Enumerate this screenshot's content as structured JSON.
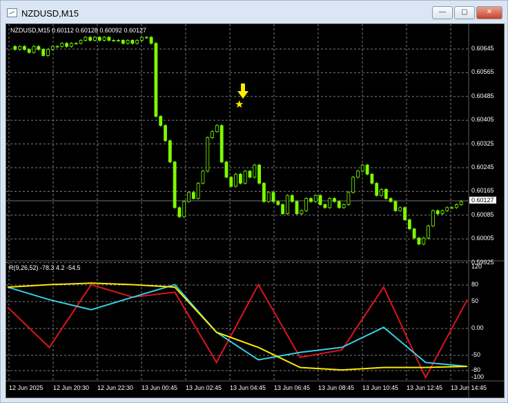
{
  "window": {
    "title": "NZDUSD,M15",
    "minimize_label": "—",
    "maximize_label": "▢",
    "close_label": "✕"
  },
  "chart": {
    "header_text": "NZDUSD,M15  0.60112 0.60128 0.60092 0.60127",
    "current_price_label": "0.60127",
    "price_axis_labels": [
      "0.60645",
      "0.60565",
      "0.60485",
      "0.60405",
      "0.60325",
      "0.60245",
      "0.60165",
      "0.60085",
      "0.60005",
      "0.59925"
    ],
    "time_axis_labels": [
      "12 Jun 2025",
      "12 Jun 20:30",
      "12 Jun 22:30",
      "13 Jun 00:45",
      "13 Jun 02:45",
      "13 Jun 04:45",
      "13 Jun 06:45",
      "13 Jun 08:45",
      "13 Jun 10:45",
      "13 Jun 12:45",
      "13 Jun 14:45"
    ],
    "signal_icon": "yellow-down-arrow-and-star",
    "colors": {
      "background": "#000000",
      "grid": "#808080",
      "candle": "#7cfc00",
      "cyan_line": "#33d1e8",
      "yellow_line": "#ffea00",
      "red_line": "#e0141e",
      "signal": "#ffea00"
    }
  },
  "indicator": {
    "header_text": "R(9,26,52) -78.3 4.2 -54.5",
    "axis_labels": [
      "120",
      "80",
      "50",
      "0.00",
      "-50",
      "-80",
      "-100"
    ]
  },
  "chart_data": {
    "type": "line",
    "title": "",
    "x": [
      "12 Jun 2025",
      "12 Jun 20:30",
      "12 Jun 22:30",
      "13 Jun 00:45",
      "13 Jun 02:45",
      "13 Jun 04:45",
      "13 Jun 06:45",
      "13 Jun 08:45",
      "13 Jun 10:45",
      "13 Jun 12:45",
      "13 Jun 14:45"
    ],
    "ylim": [
      -100,
      120
    ],
    "series": [
      {
        "name": "9",
        "values": [
          40,
          -40,
          85,
          60,
          70,
          -70,
          85,
          -60,
          -45,
          80,
          -100,
          55
        ]
      },
      {
        "name": "26",
        "values": [
          80,
          55,
          35,
          60,
          85,
          -10,
          -65,
          -50,
          -40,
          0,
          -70,
          -78
        ]
      },
      {
        "name": "52",
        "values": [
          80,
          85,
          88,
          85,
          80,
          -10,
          -40,
          -80,
          -85,
          -80,
          -80,
          -78
        ]
      }
    ],
    "price_ylim": [
      0.59925,
      0.60685
    ],
    "ohlc_close_last": 0.60127
  }
}
